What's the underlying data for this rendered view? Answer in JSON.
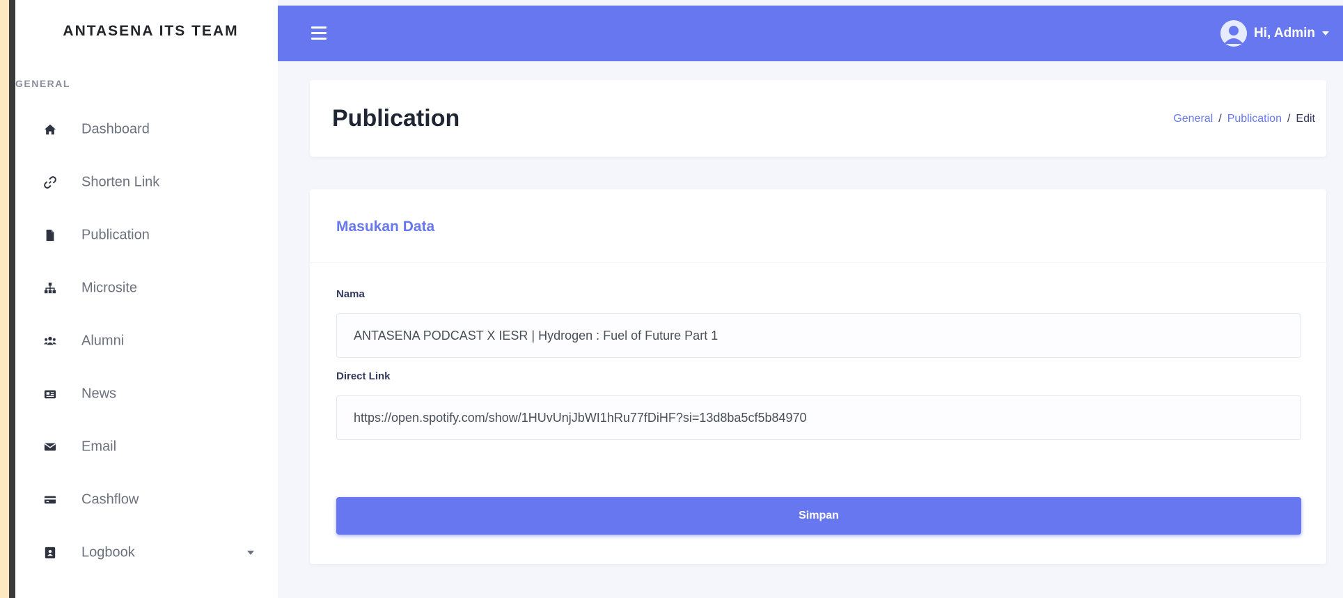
{
  "sidebar": {
    "brand": "ANTASENA ITS TEAM",
    "section_label": "GENERAL",
    "items": [
      {
        "label": "Dashboard",
        "icon": "home-icon"
      },
      {
        "label": "Shorten Link",
        "icon": "link-icon"
      },
      {
        "label": "Publication",
        "icon": "file-icon"
      },
      {
        "label": "Microsite",
        "icon": "sitemap-icon"
      },
      {
        "label": "Alumni",
        "icon": "users-icon"
      },
      {
        "label": "News",
        "icon": "newspaper-icon"
      },
      {
        "label": "Email",
        "icon": "envelope-icon"
      },
      {
        "label": "Cashflow",
        "icon": "credit-card-icon"
      },
      {
        "label": "Logbook",
        "icon": "address-book-icon",
        "has_dropdown": true
      }
    ]
  },
  "topbar": {
    "menu_icon": "hamburger-icon",
    "user_greeting": "Hi, Admin",
    "accent_color": "#6777ef"
  },
  "header": {
    "title": "Publication",
    "breadcrumb": [
      "General",
      "Publication",
      "Edit"
    ],
    "breadcrumb_separator": "/"
  },
  "form": {
    "title": "Masukan Data",
    "fields": [
      {
        "label": "Nama",
        "value": "ANTASENA PODCAST X IESR | Hydrogen : Fuel of Future Part 1"
      },
      {
        "label": "Direct Link",
        "value": "https://open.spotify.com/show/1HUvUnjJbWI1hRu77fDiHF?si=13d8ba5cf5b84970"
      }
    ],
    "submit_label": "Simpan"
  }
}
